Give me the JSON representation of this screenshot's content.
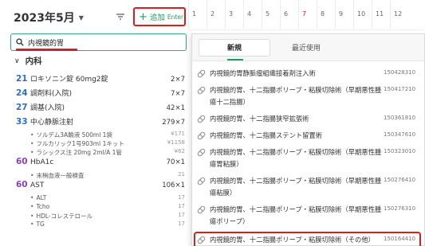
{
  "header": {
    "month": "2023年5月",
    "add_label": "追加",
    "add_hint": "Enter"
  },
  "day_numbers": [
    "1",
    "2",
    "3",
    "4",
    "5",
    "6",
    "7",
    "8",
    "9",
    "10",
    "11",
    "12"
  ],
  "search": {
    "value": "内視鏡的胃"
  },
  "section": {
    "title": "内科"
  },
  "left_items": [
    {
      "num": "21",
      "name": "ロキソニン錠 60mg2錠",
      "qty": "2×7",
      "subs": []
    },
    {
      "num": "24",
      "name": "調剤料(入院)",
      "qty": "7×7",
      "subs": []
    },
    {
      "num": "27",
      "name": "調基(入院)",
      "qty": "42×1",
      "subs": []
    },
    {
      "num": "33",
      "name": "中心静脈注射",
      "qty": "279×7",
      "subs": [
        {
          "name": "ソルデム3A輸液 500ml 1袋",
          "qty": "¥171"
        },
        {
          "name": "フルカリック1号903ml 1キット",
          "qty": "¥1158"
        },
        {
          "name": "ラシックス注 20mg 2ml/A 1管",
          "qty": "¥62"
        }
      ]
    },
    {
      "num": "60",
      "name": "HbA1c",
      "qty": "70×1",
      "subs": [
        {
          "name": "末梢血液一般検査",
          "qty": "21"
        }
      ]
    },
    {
      "num": "60",
      "name": "AST",
      "qty": "106×1",
      "subs": [
        {
          "name": "ALT",
          "qty": "17"
        },
        {
          "name": "Tcho",
          "qty": "17"
        },
        {
          "name": "HDL-コレステロール",
          "qty": "17"
        },
        {
          "name": "TG",
          "qty": "17"
        }
      ]
    }
  ],
  "dropdown": {
    "tabs": [
      "新規",
      "最近使用"
    ],
    "items": [
      {
        "text": "内視鏡的胃静脈瘤組織接着剤注入術",
        "code": "150428310"
      },
      {
        "text": "内視鏡的胃、十二指腸ポリープ・粘膜切除術（早期悪性腫瘍十二指腸）",
        "code": "150417210"
      },
      {
        "text": "内視鏡的胃、十二指腸狭窄拡張術",
        "code": "150361810"
      },
      {
        "text": "内視鏡的胃、十二指腸ステント留置術",
        "code": "150347610"
      },
      {
        "text": "内視鏡的胃、十二指腸ポリープ・粘膜切除術（早期悪性腫瘍胃粘膜）",
        "code": "150323010"
      },
      {
        "text": "内視鏡的胃、十二指腸ポリープ・粘膜切除術（早期悪性腫瘍粘膜）",
        "code": "150276410"
      },
      {
        "text": "内視鏡的胃、十二指腸ポリープ・粘膜切除術（早期悪性腫瘍ポリープ）",
        "code": "150276310"
      },
      {
        "text": "内視鏡的胃、十二指腸ポリープ・粘膜切除術（その他）",
        "code": "150164410"
      }
    ]
  },
  "colors": {
    "accent_green": "#18a35f",
    "highlight_red": "#d42020",
    "number_blue": "#2a6fcf",
    "number_purple": "#8b3fb8"
  }
}
